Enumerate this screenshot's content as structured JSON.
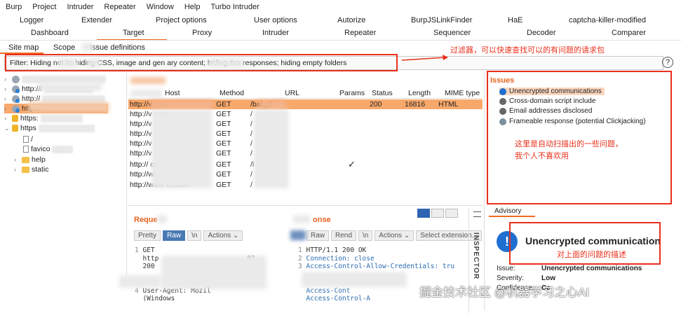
{
  "menu": [
    "Burp",
    "Project",
    "Intruder",
    "Repeater",
    "Window",
    "Help",
    "Turbo Intruder"
  ],
  "tabs_row1": [
    "Logger",
    "Extender",
    "Project options",
    "User options",
    "Autorize",
    "BurpJSLinkFinder",
    "HaE",
    "captcha-killer-modified"
  ],
  "tabs_row2": [
    "Dashboard",
    "Target",
    "Proxy",
    "Intruder",
    "Repeater",
    "Sequencer",
    "Decoder",
    "Comparer"
  ],
  "subtabs": [
    "Site map",
    "Scope",
    "Issue definitions"
  ],
  "filter": {
    "text": "Filter: Hiding not        ite      hiding CSS, image and gen          ary content;  hiding 4xx responses;  hiding empty folders",
    "annotation": "过滤器，可以快速查找可以的有问题的请求包"
  },
  "tree": {
    "hosts": [
      "http://l",
      "http://",
      "http://",
      "http://",
      "https:",
      "https"
    ],
    "children": [
      "/",
      "favico",
      "help",
      "static"
    ]
  },
  "table": {
    "headers": [
      "Host",
      "Method",
      "URL",
      "Params",
      "Status",
      "Length",
      "MIME type"
    ],
    "rows": [
      {
        "host": "http://v                  com",
        "method": "GET",
        "url": "/baby2",
        "params": "",
        "status": "200",
        "length": "16816",
        "mime": "HTML"
      },
      {
        "host": "http://v                  com",
        "method": "GET",
        "url": "/",
        "params": "",
        "status": "",
        "length": "",
        "mime": ""
      },
      {
        "host": "http://v                  com",
        "method": "GET",
        "url": "/",
        "params": "",
        "status": "",
        "length": "",
        "mime": ""
      },
      {
        "host": "http://v                  com",
        "method": "GET",
        "url": "/",
        "params": "",
        "status": "",
        "length": "",
        "mime": ""
      },
      {
        "host": "http://v                  com",
        "method": "GET",
        "url": "/",
        "params": "",
        "status": "",
        "length": "",
        "mime": ""
      },
      {
        "host": "http://v                  com",
        "method": "GET",
        "url": "/",
        "params": "",
        "status": "",
        "length": "",
        "mime": ""
      },
      {
        "host": "http://                   com",
        "method": "GET",
        "url": "/l",
        "params": "",
        "status": "",
        "length": "",
        "mime": ""
      },
      {
        "host": "http://www              ee.com",
        "method": "GET",
        "url": "/",
        "params": "",
        "status": "",
        "length": "",
        "mime": ""
      },
      {
        "host": "http://www              ee.com",
        "method": "GET",
        "url": "/",
        "params": "",
        "status": "",
        "length": "",
        "mime": ""
      }
    ],
    "check": "✓"
  },
  "issues": {
    "title": "Issues",
    "items": [
      {
        "label": "Unencrypted communications",
        "icon": "info-blue"
      },
      {
        "label": "Cross-domain script include",
        "icon": "info-gray"
      },
      {
        "label": "Email addresses disclosed",
        "icon": "info-gray"
      },
      {
        "label": "Frameable response (potential Clickjacking)",
        "icon": "info-light"
      }
    ],
    "annotation_line1": "这里是自动扫描出的一些问题，",
    "annotation_line2": "我个人不喜欢用"
  },
  "request": {
    "title": "Reque",
    "buttons": [
      "Pretty",
      "Raw",
      "\\n",
      "Actions ⌄"
    ],
    "lines": [
      {
        "n": "1",
        "t": "GET"
      },
      {
        "n": "",
        "t": "http"
      },
      {
        "n": "",
        "t": "200"
      },
      {
        "n": "",
        "t": ""
      },
      {
        "n": "",
        "t": ""
      },
      {
        "n": "",
        "t": ""
      },
      {
        "n": "4",
        "t": "User-Agent: Mozil"
      },
      {
        "n": "",
        "t": "(Windows"
      }
    ],
    "line1_suffix": "02"
  },
  "response": {
    "title": "onse",
    "buttons": [
      "Raw",
      "Rend",
      "\\n",
      "Actions ⌄",
      "Select extension..."
    ],
    "lines": [
      {
        "n": "1",
        "t": "HTTP/1.1 200 OK"
      },
      {
        "n": "2",
        "t": "Connection: close"
      },
      {
        "n": "3",
        "t": "Access-Control-Allow-Credentials: tru"
      },
      {
        "n": "",
        "t": ""
      },
      {
        "n": "",
        "t": ""
      },
      {
        "n": "",
        "t": "Access-Cont"
      },
      {
        "n": "",
        "t": "Access-Control-A"
      }
    ]
  },
  "inspector_label": "INSPECTOR",
  "advisory": {
    "tab": "Advisory",
    "title": "Unencrypted communication",
    "annotation": "对上面的问题的描述",
    "issue_label": "Issue:",
    "issue_value": "Unencrypted communications",
    "severity_label": "Severity:",
    "severity_value": "Low",
    "confidence_label": "Confidence:",
    "confidence_value": "Ce"
  },
  "watermark": "掘金技术社区 @机器学习之心AI",
  "colors": {
    "accent": "#f26a21",
    "annotation": "#e8301c",
    "selected_row": "#f9a86b",
    "info_blue": "#1f6fd1"
  }
}
